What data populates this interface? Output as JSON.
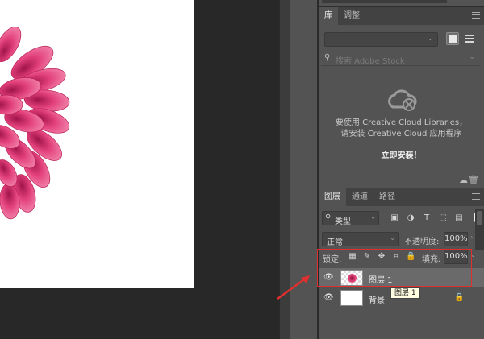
{
  "library_panel": {
    "tabs": [
      {
        "label": "库"
      },
      {
        "label": "调整"
      }
    ],
    "search_placeholder": "搜索 Adobe Stock",
    "message_line1": "要使用 Creative Cloud Libraries，",
    "message_line2": "请安装 Creative Cloud 应用程序",
    "install_link": "立即安装！"
  },
  "layers_panel": {
    "tabs": [
      {
        "label": "图层"
      },
      {
        "label": "通道"
      },
      {
        "label": "路径"
      }
    ],
    "filter_kind": "类型",
    "blend_mode": "正常",
    "opacity_label": "不透明度:",
    "opacity_value": "100%",
    "lock_label": "锁定:",
    "fill_label": "填充:",
    "fill_value": "100%",
    "layers": [
      {
        "name": "图层 1",
        "selected": true
      },
      {
        "name": "背景",
        "selected": false,
        "locked": true
      }
    ],
    "tooltip": "图层 1"
  },
  "colors": {
    "highlight": "#e0302e",
    "arrow": "#e0302e"
  }
}
